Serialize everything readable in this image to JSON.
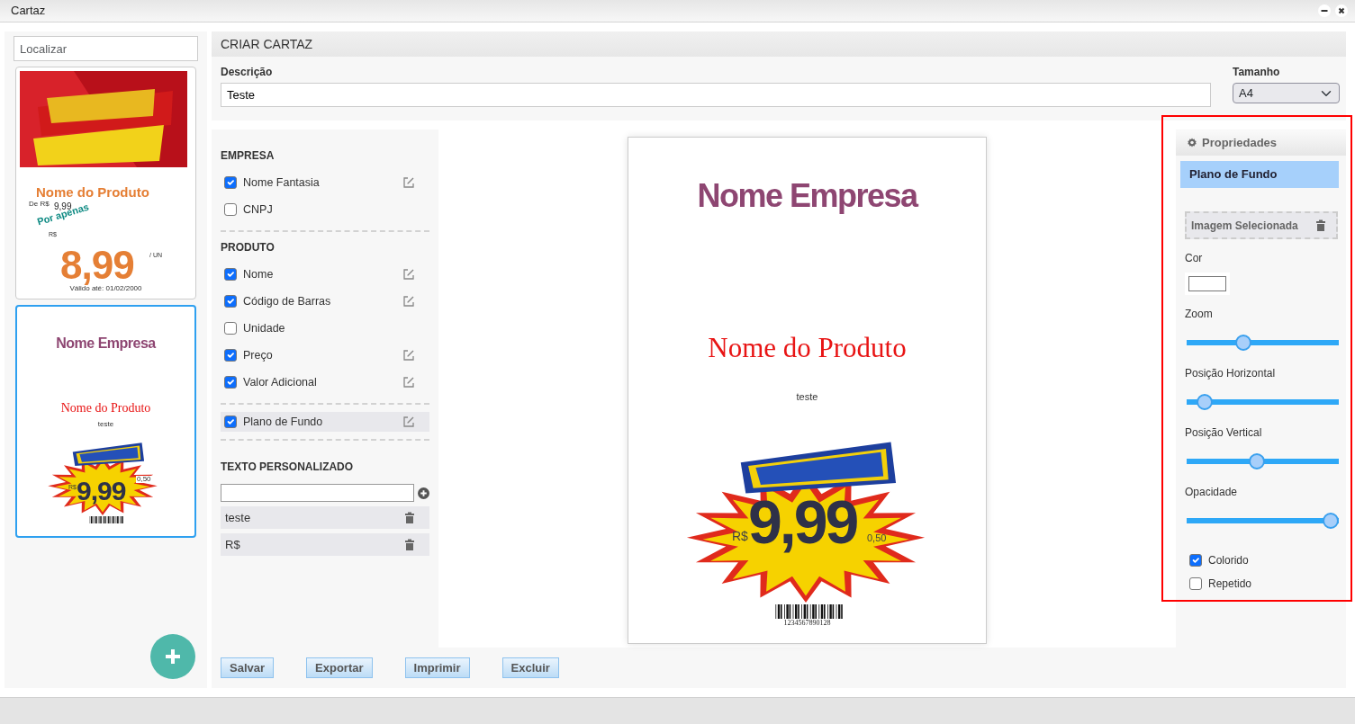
{
  "window": {
    "title": "Cartaz"
  },
  "sidebar": {
    "search": {
      "placeholder": "Localizar"
    },
    "templates": [
      {
        "kind": "ofertas",
        "selected": false,
        "product": "Nome do Produto",
        "old_price_label": "De R$",
        "old_price": "9,99",
        "promo_label": "Por apenas",
        "currency": "R$",
        "price": "8,99",
        "unit": "/ UN",
        "validity": "Válido até: 01/02/2000"
      },
      {
        "kind": "promo",
        "selected": true,
        "company": "Nome Empresa",
        "product": "Nome do Produto",
        "note": "teste",
        "currency": "R$",
        "price": "9,99",
        "extra": "0,50"
      }
    ]
  },
  "header": "CRIAR CARTAZ",
  "form": {
    "description": {
      "label": "Descrição",
      "value": "Teste"
    },
    "size": {
      "label": "Tamanho",
      "value": "A4"
    }
  },
  "sections": [
    {
      "title": "EMPRESA",
      "items": [
        {
          "label": "Nome Fantasia",
          "checked": true,
          "selected": false
        },
        {
          "label": "CNPJ",
          "checked": false,
          "selected": false
        }
      ]
    },
    {
      "title": "PRODUTO",
      "items": [
        {
          "label": "Nome",
          "checked": true,
          "selected": false
        },
        {
          "label": "Código de Barras",
          "checked": true,
          "selected": false
        },
        {
          "label": "Unidade",
          "checked": false,
          "selected": false
        },
        {
          "label": "Preço",
          "checked": true,
          "selected": false
        },
        {
          "label": "Valor Adicional",
          "checked": true,
          "selected": false
        }
      ]
    },
    {
      "items": [
        {
          "label": "Plano de Fundo",
          "checked": true,
          "selected": true
        }
      ]
    }
  ],
  "custom_text": {
    "title": "TEXTO PERSONALIZADO",
    "items": [
      "teste",
      "R$"
    ]
  },
  "buttons": [
    "Salvar",
    "Exportar",
    "Imprimir",
    "Excluir"
  ],
  "preview": {
    "company": "Nome Empresa",
    "product": "Nome do Produto",
    "note": "teste",
    "currency": "R$",
    "price": "9,99",
    "extra": "0,50",
    "barcode": "1234567890128"
  },
  "properties": {
    "title": "Propriedades",
    "section": "Plano de Fundo",
    "image_label": "Imagem Selecionada",
    "color": {
      "label": "Cor"
    },
    "sliders": [
      {
        "label": "Zoom",
        "level": 0.36
      },
      {
        "label": "Posição Horizontal",
        "level": 0.07
      },
      {
        "label": "Posição Vertical",
        "level": 0.46
      },
      {
        "label": "Opacidade",
        "level": 1
      }
    ],
    "checks": [
      {
        "label": "Colorido",
        "checked": true
      },
      {
        "label": "Repetido",
        "checked": false
      }
    ]
  }
}
